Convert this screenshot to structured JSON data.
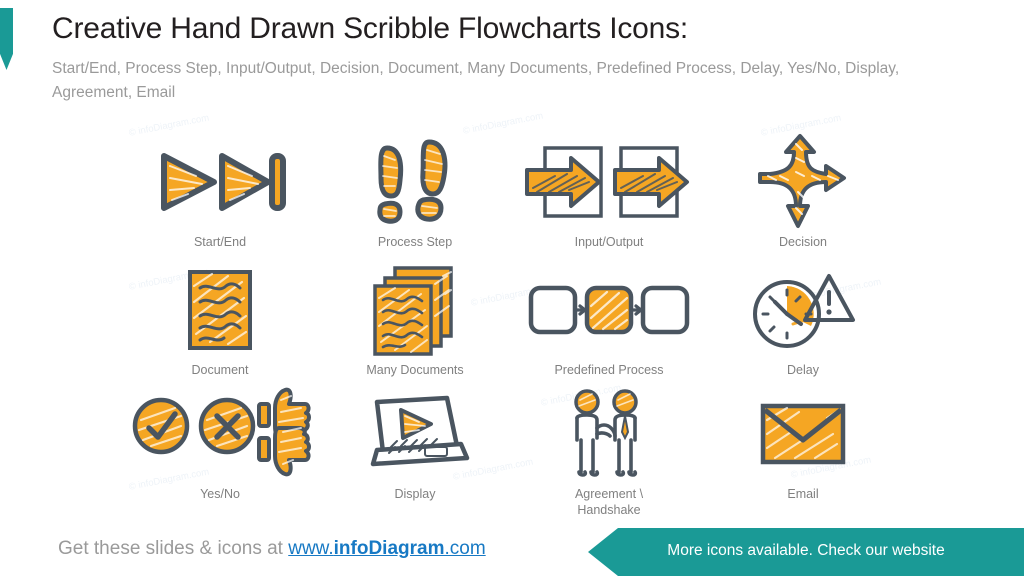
{
  "header": {
    "title": "Creative Hand Drawn Scribble Flowcharts Icons:",
    "subtitle": "Start/End, Process Step, Input/Output, Decision, Document, Many Documents, Predefined Process, Delay, Yes/No, Display, Agreement, Email"
  },
  "colors": {
    "accent_teal": "#1A9A96",
    "icon_orange": "#F5A623",
    "icon_outline": "#4A5560",
    "caption_gray": "#808080",
    "link_blue": "#1779C4"
  },
  "icons": [
    {
      "id": "start-end",
      "label": "Start/End"
    },
    {
      "id": "process-step",
      "label": "Process Step"
    },
    {
      "id": "input-output",
      "label": "Input/Output"
    },
    {
      "id": "decision",
      "label": "Decision"
    },
    {
      "id": "document",
      "label": "Document"
    },
    {
      "id": "many-documents",
      "label": "Many Documents"
    },
    {
      "id": "predefined-process",
      "label": "Predefined Process"
    },
    {
      "id": "delay",
      "label": "Delay"
    },
    {
      "id": "yes-no",
      "label": "Yes/No"
    },
    {
      "id": "display",
      "label": "Display"
    },
    {
      "id": "agreement",
      "label": "Agreement \\\nHandshake"
    },
    {
      "id": "email",
      "label": "Email"
    }
  ],
  "watermark": {
    "text": "© infoDiagram.com"
  },
  "footer": {
    "cta_prefix": "Get these slides & icons at ",
    "link_www": "www.",
    "link_brand": "infoDiagram",
    "link_tld": ".com",
    "banner_text": "More icons available. Check our website"
  }
}
